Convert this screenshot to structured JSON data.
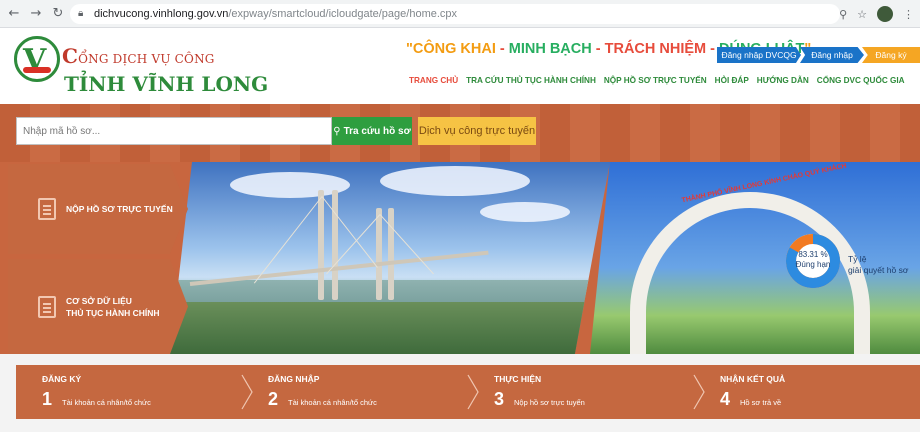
{
  "browser": {
    "url_host": "dichvucong.vinhlong.gov.vn",
    "url_path": "/expway/smartcloud/icloudgate/page/home.cpx"
  },
  "header": {
    "brand_line1_initial": "C",
    "brand_line1_rest": "ỔNG DỊCH VỤ CÔNG",
    "brand_line2_initial": "T",
    "brand_line2_rest": "ỈNH VĨNH LONG",
    "slogan": {
      "open_quote": "\"",
      "part1": "CÔNG KHAI",
      "sep1": " - ",
      "part2": "MINH BẠCH",
      "sep2": " - ",
      "part3": "TRÁCH NHIỆM",
      "sep3": " - ",
      "part4": "ĐÚNG LUẬT",
      "close_quote": "\""
    },
    "buttons": {
      "login_dvcqg": "Đăng nhập DVCQG",
      "login": "Đăng nhập",
      "register": "Đăng ký"
    },
    "nav": [
      {
        "label": "TRANG CHỦ"
      },
      {
        "label": "TRA CỨU THỦ TỤC HÀNH CHÍNH"
      },
      {
        "label": "NỘP HỒ SƠ TRỰC TUYẾN"
      },
      {
        "label": "HỎI ĐÁP"
      },
      {
        "label": "HƯỚNG DẪN"
      },
      {
        "label": "CỔNG DVC QUỐC GIA"
      }
    ]
  },
  "search": {
    "placeholder": "Nhập mã hồ sơ...",
    "button_label": "Tra cứu hồ sơ",
    "service_button": "Dịch vụ công trực tuyến"
  },
  "panels": [
    {
      "label_line1": "NỘP HỒ SƠ TRỰC TUYẾN",
      "label_line2": ""
    },
    {
      "label_line1": "CƠ SỞ DỮ LIỆU",
      "label_line2": "THỦ TỤC HÀNH CHÍNH"
    }
  ],
  "gate": {
    "text": "THÀNH PHỐ VĨNH LONG KÍNH CHÀO QUÝ KHÁCH"
  },
  "stat": {
    "percent_text": "83.31 %",
    "sub_text": "Đúng hạn",
    "on_time_fraction": 0.8331,
    "caption_line1": "Tỷ lệ",
    "caption_line2": "giải quyết hồ sơ",
    "color_on_time": "#2d8be0",
    "color_rest": "#f27a21"
  },
  "steps": [
    {
      "title": "ĐĂNG KÝ",
      "num": "1",
      "sub": "Tài khoản cá nhân/tổ chức"
    },
    {
      "title": "ĐĂNG NHẬP",
      "num": "2",
      "sub": "Tài khoản cá nhân/tổ chức"
    },
    {
      "title": "THỰC HIỆN",
      "num": "3",
      "sub": "Nộp hồ sơ trực tuyến"
    },
    {
      "title": "NHẬN KẾT QUẢ",
      "num": "4",
      "sub": "Hồ sơ trả về"
    }
  ]
}
